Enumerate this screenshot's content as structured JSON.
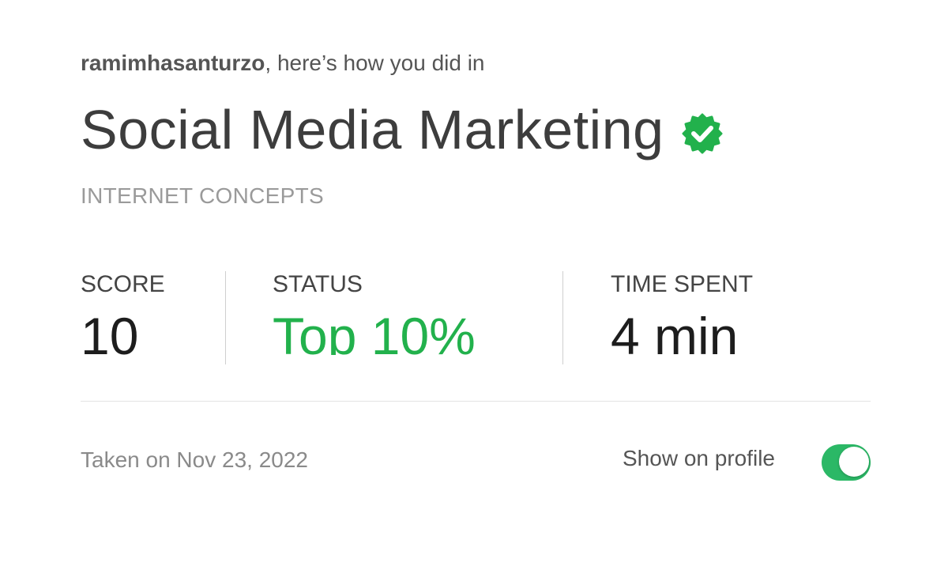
{
  "intro": {
    "username": "ramimhasanturzo",
    "suffix": ", here’s how you did in"
  },
  "assessment": {
    "title": "Social Media Marketing",
    "verified_icon": "verified-badge-icon",
    "category": "INTERNET CONCEPTS"
  },
  "stats": {
    "score_label": "SCORE",
    "score_value": "10",
    "status_label": "STATUS",
    "status_value": "Top 10%",
    "time_label": "TIME SPENT",
    "time_value": "4 min"
  },
  "footer": {
    "taken_on": "Taken on Nov 23, 2022",
    "show_on_profile_label": "Show on profile",
    "show_on_profile_enabled": true
  },
  "colors": {
    "accent_green": "#22b14c",
    "toggle_on": "#2bb866",
    "text_dark": "#3d3d3d",
    "text_muted": "#9a9a9a"
  }
}
